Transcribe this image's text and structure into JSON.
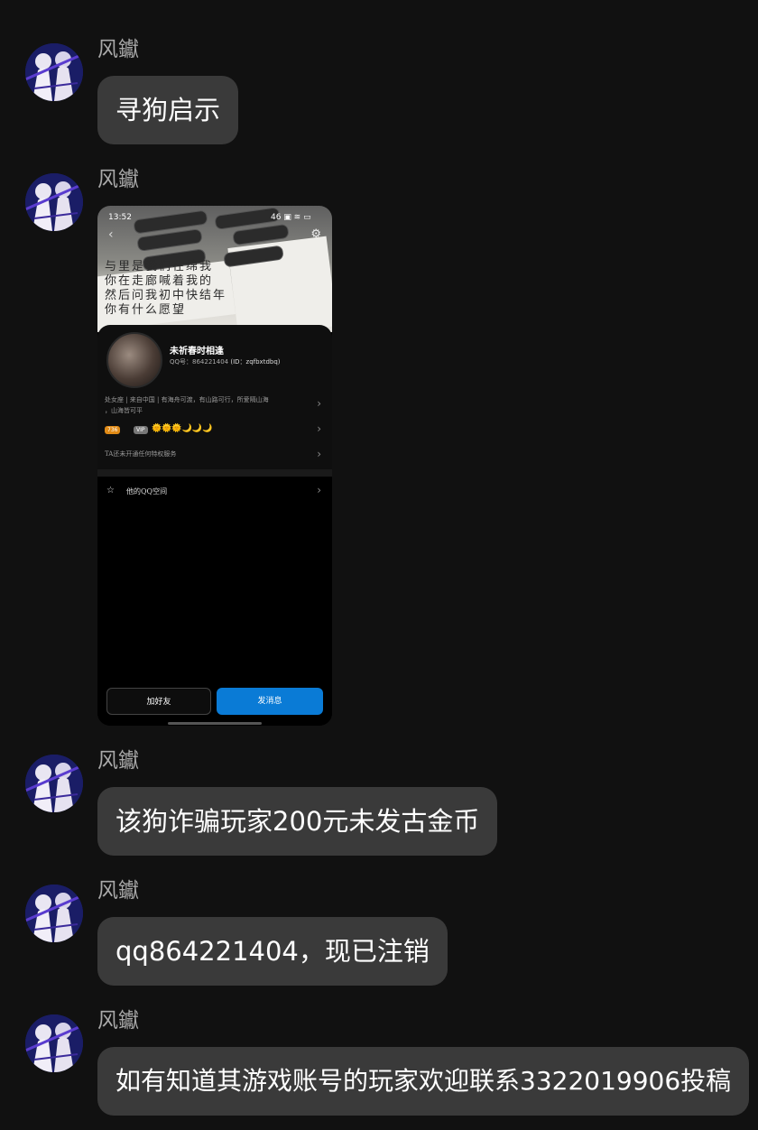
{
  "messages": [
    {
      "sender": "风钀",
      "text": "寻狗启示"
    },
    {
      "sender": "风钀",
      "type": "image"
    },
    {
      "sender": "风钀",
      "text": "该狗诈骗玩家200元未发古金币"
    },
    {
      "sender": "风钀",
      "text": "qq864221404，现已注销"
    },
    {
      "sender": "风钀",
      "text": "如有知道其游戏账号的玩家欢迎联系3322019906投稿"
    }
  ],
  "screenshot": {
    "status_time": "13:52",
    "status_icons": "46 ▣ ≋ ▭",
    "handwriting": [
      "与里是我们在绵我",
      "你在走廊喊着我的",
      "然后问我初中快结年",
      "你有什么愿望"
    ],
    "profile_name": "未祈春时相逢",
    "qq_label": "QQ号：864221404",
    "qq_id": "(ID：zqfbxtdbq)",
    "bio_line1": "处女座 | 来自中国 | 有海舟可渡，有山路可行，所爱隔山海",
    "bio_line2": "，山海皆可平",
    "level_badge": "736",
    "vip_badge": "VIP",
    "level_icons": "🌞🌞🌞🌙🌙🌙",
    "service_text": "TA还未开通任何特权服务",
    "qzone_label": "他的QQ空间",
    "add_friend": "加好友",
    "send_message": "发消息",
    "colors": {
      "send_button": "#0a7bd6"
    }
  },
  "colors": {
    "background": "#111111",
    "bubble": "#3a3a3a",
    "sender": "#a9a9a9"
  }
}
